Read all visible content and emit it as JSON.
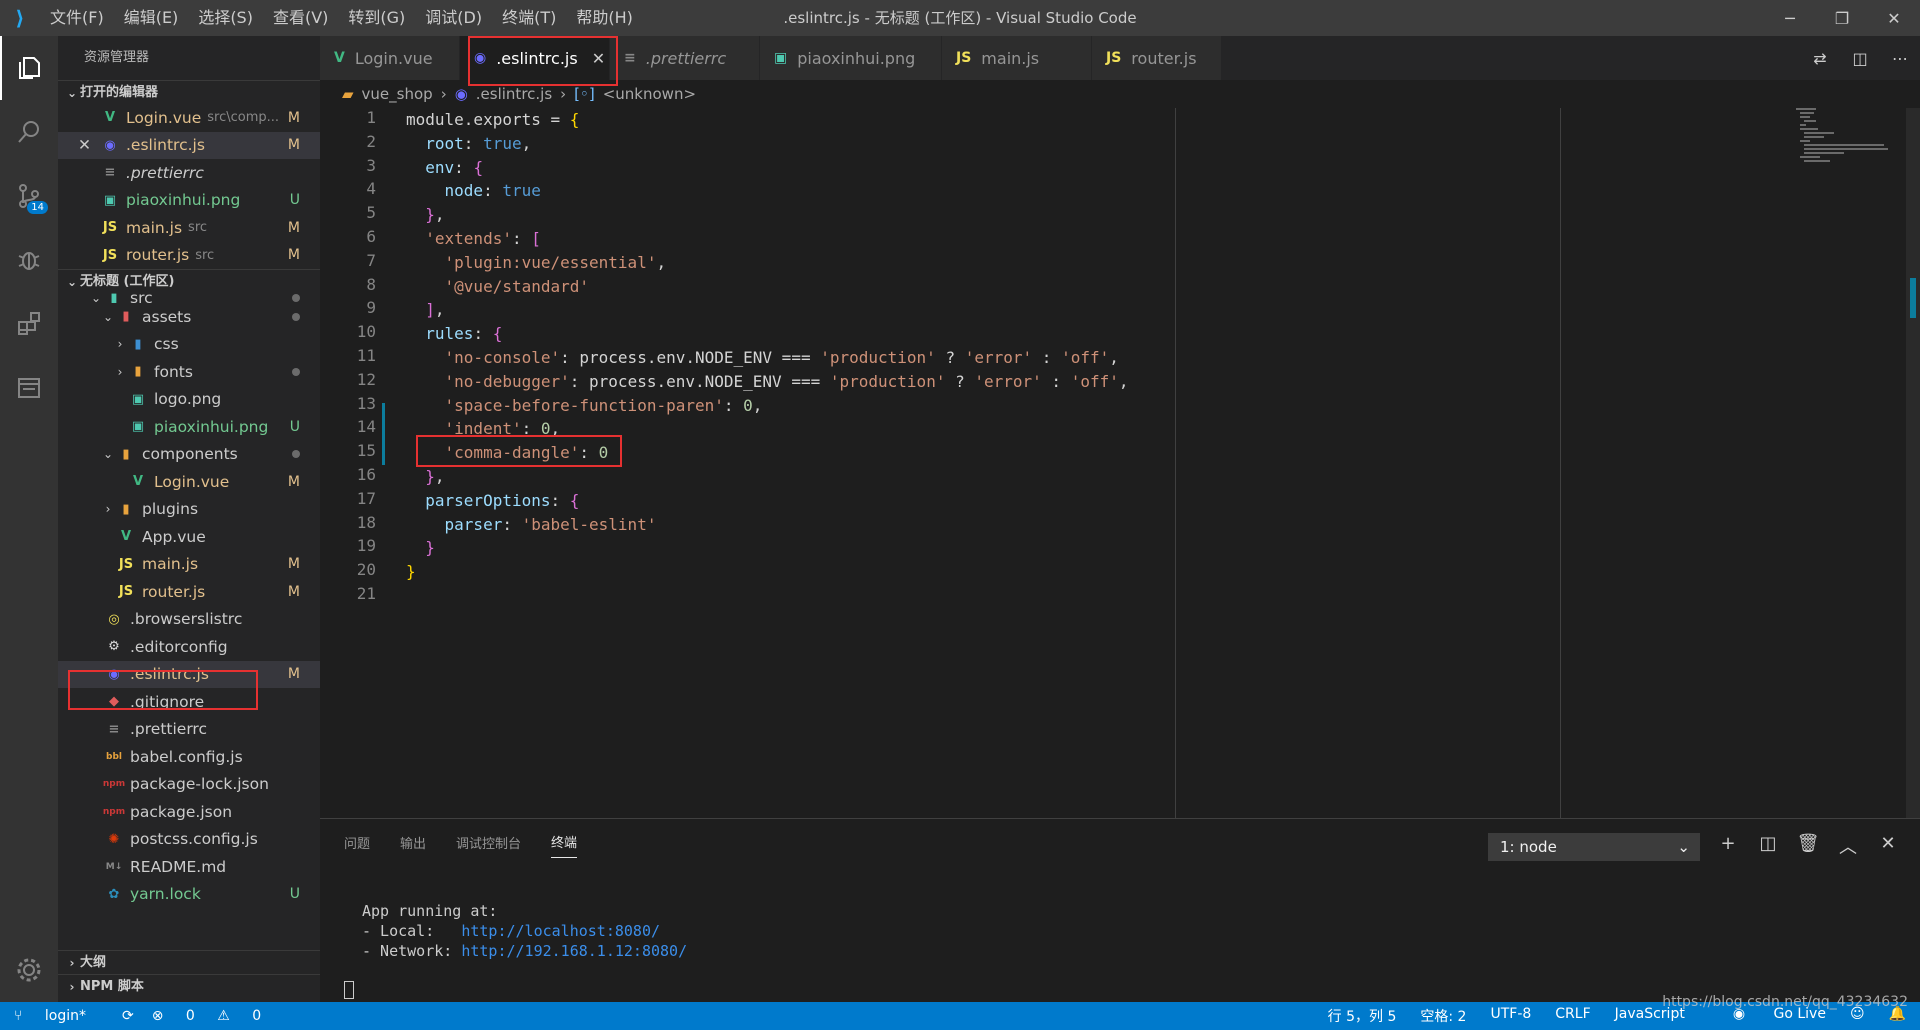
{
  "window": {
    "title": ".eslintrc.js - 无标题 (工作区) - Visual Studio Code"
  },
  "menu": [
    "文件(F)",
    "编辑(E)",
    "选择(S)",
    "查看(V)",
    "转到(G)",
    "调试(D)",
    "终端(T)",
    "帮助(H)"
  ],
  "activity": {
    "scm_badge": "14"
  },
  "sidebar": {
    "title": "资源管理器",
    "open_editors_label": "打开的编辑器",
    "open_editors": [
      {
        "name": "Login.vue",
        "sub": "src\\comp...",
        "status": "M"
      },
      {
        "name": ".eslintrc.js",
        "sub": "",
        "status": "M"
      },
      {
        "name": ".prettierrc",
        "sub": "",
        "status": ""
      },
      {
        "name": "piaoxinhui.png",
        "sub": "",
        "status": "U"
      },
      {
        "name": "main.js",
        "sub": "src",
        "status": "M"
      },
      {
        "name": "router.js",
        "sub": "src",
        "status": "M"
      }
    ],
    "workspace_label": "无标题 (工作区)",
    "tree": [
      {
        "name": "src"
      },
      {
        "name": "assets"
      },
      {
        "name": "css"
      },
      {
        "name": "fonts"
      },
      {
        "name": "logo.png"
      },
      {
        "name": "piaoxinhui.png",
        "status": "U"
      },
      {
        "name": "components"
      },
      {
        "name": "Login.vue",
        "status": "M"
      },
      {
        "name": "plugins"
      },
      {
        "name": "App.vue"
      },
      {
        "name": "main.js",
        "status": "M"
      },
      {
        "name": "router.js",
        "status": "M"
      },
      {
        "name": ".browserslistrc"
      },
      {
        "name": ".editorconfig"
      },
      {
        "name": ".eslintrc.js",
        "status": "M"
      },
      {
        "name": ".gitignore"
      },
      {
        "name": ".prettierrc"
      },
      {
        "name": "babel.config.js"
      },
      {
        "name": "package-lock.json"
      },
      {
        "name": "package.json"
      },
      {
        "name": "postcss.config.js"
      },
      {
        "name": "README.md"
      },
      {
        "name": "yarn.lock",
        "status": "U"
      }
    ],
    "outline_label": "大纲",
    "npm_label": "NPM 脚本"
  },
  "tabs": [
    {
      "label": "Login.vue"
    },
    {
      "label": ".eslintrc.js"
    },
    {
      "label": ".prettierrc"
    },
    {
      "label": "piaoxinhui.png"
    },
    {
      "label": "main.js"
    },
    {
      "label": "router.js"
    }
  ],
  "breadcrumb": [
    "vue_shop",
    ".eslintrc.js",
    "<unknown>"
  ],
  "code": {
    "line_numbers": [
      "1",
      "2",
      "3",
      "4",
      "5",
      "6",
      "7",
      "8",
      "9",
      "10",
      "11",
      "12",
      "13",
      "14",
      "15",
      "16",
      "17",
      "18",
      "19",
      "20",
      "21"
    ]
  },
  "panel": {
    "tabs": [
      "问题",
      "输出",
      "调试控制台",
      "终端"
    ],
    "terminal_select": "1: node",
    "lines": {
      "l1": "App running at:",
      "l2a": "- Local:   ",
      "l2b": "http://localhost:8080/",
      "l3a": "- Network: ",
      "l3b": "http://192.168.1.12:8080/"
    }
  },
  "status": {
    "branch": "login*",
    "errors": "0",
    "warnings": "0",
    "position": "行 5，列 5",
    "spaces": "空格: 2",
    "encoding": "UTF-8",
    "eol": "CRLF",
    "language": "JavaScript",
    "golive": "Go Live",
    "watermark": "https://blog.csdn.net/qq_43234632"
  }
}
